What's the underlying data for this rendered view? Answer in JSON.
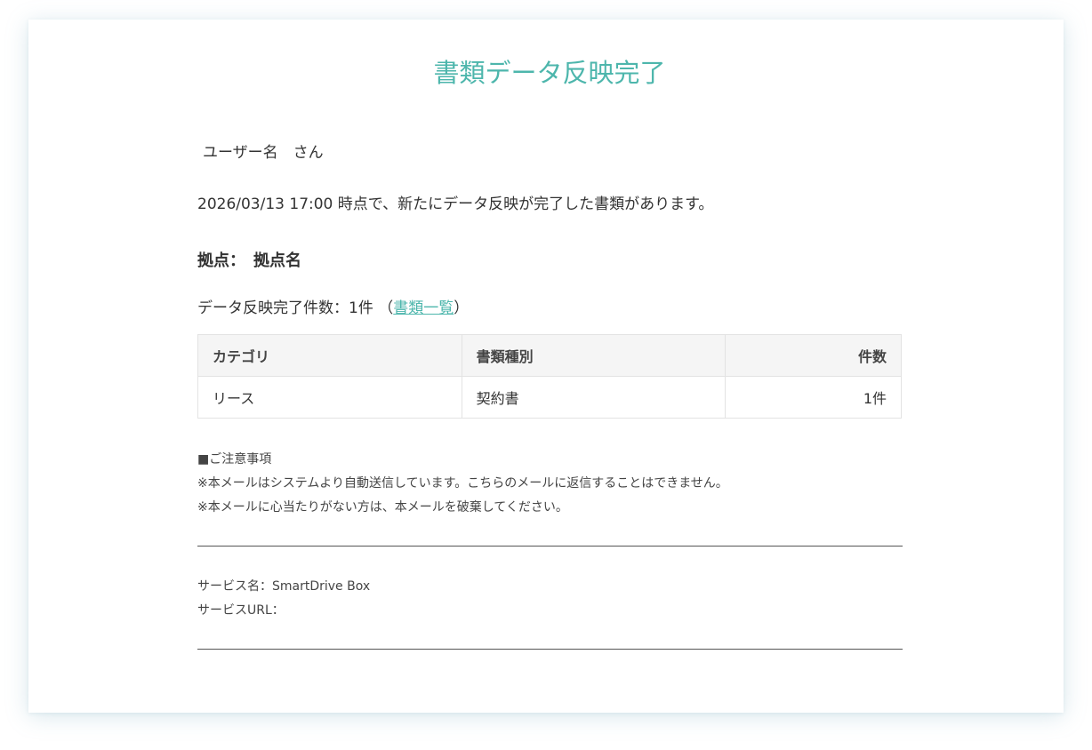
{
  "email": {
    "title": "書類データ反映完了",
    "greeting": "ユーザー名　さん",
    "notice": "2026/03/13 17:00 時点で、新たにデータ反映が完了した書類があります。",
    "site_line": "拠点：　拠点名",
    "count_text": "データ反映完了件数：1件 （",
    "count_link": "書類一覧",
    "count_close": "）",
    "table": {
      "headers": [
        "カテゴリ",
        "書類種別",
        "件数"
      ],
      "rows": [
        [
          "リース",
          "契約書",
          "1件"
        ]
      ]
    },
    "caution": {
      "heading": "■ご注意事項",
      "line1": "※本メールはシステムより自動送信しています。こちらのメールに返信することはできません。",
      "line2": "※本メールに心当たりがない方は、本メールを破棄してください。"
    },
    "service": {
      "name_line": "サービス名：SmartDrive Box",
      "url_line": "サービスURL："
    }
  },
  "colors": {
    "accent": "#4db6ac",
    "text": "#333333",
    "table_header_bg": "#f5f5f5"
  }
}
